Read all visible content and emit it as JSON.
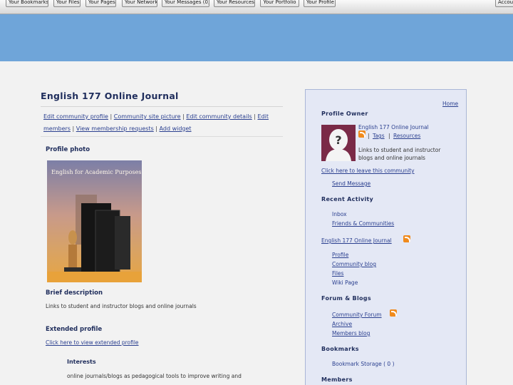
{
  "toolbar": {
    "buttons": [
      "Your Bookmarks",
      "Your Files",
      "Your Pages",
      "Your Network",
      "Your Messages (0)",
      "Your Resources",
      "Your Portfolio",
      "Your Profile"
    ],
    "account": "Account"
  },
  "main": {
    "title": "English 177 Online Journal",
    "owner_links": {
      "edit_profile": "Edit community profile",
      "edit_site_picture": "Community site picture",
      "edit_details": "Edit community details",
      "edit_members": "Edit members",
      "view_requests": "View membership requests",
      "add_widget": "Add widget"
    },
    "profile_photo_heading": "Profile photo",
    "photo": {
      "book_title": "English for Academic Purposes"
    },
    "brief_heading": "Brief description",
    "brief_text": "Links to student and instructor blogs and online journals",
    "extended_heading": "Extended profile",
    "extended_link": "Click here to view extended profile",
    "interests_heading": "Interests",
    "interests_text": "online journals/blogs as pedagogical tools to improve writing and"
  },
  "sidebar": {
    "home_link": "Home",
    "profile_owner_heading": "Profile Owner",
    "owner_name": "English 177 Online Journal",
    "owner_tags": "Tags",
    "owner_resources": "Resources",
    "owner_description": "Links to student and instructor blogs and online journals",
    "leave_link": "Click here to leave this community",
    "send_message": "Send Message",
    "recent_heading": "Recent Activity",
    "recent_items": [
      "Inbox",
      "Friends & Communities"
    ],
    "journal_link": "English 177 Online Journal",
    "journal_items": [
      "Profile",
      "Community blog",
      "Files",
      "Wiki Page"
    ],
    "forum_heading": "Forum & Blogs",
    "forum_items": [
      "Community Forum",
      "Archive",
      "Members blog"
    ],
    "bookmarks_heading": "Bookmarks",
    "bookmark_storage": "Bookmark Storage ( 0 )",
    "members_heading": "Members"
  },
  "colors": {
    "header_band": "#6fa5d9",
    "sidebar_bg": "#e4e8f5",
    "heading_text": "#1f2d5c",
    "link_text": "#2a3f8f",
    "rss_orange": "#f08a1c",
    "avatar_bg": "#7a2a47"
  },
  "icons": {
    "rss": "rss-feed-icon",
    "avatar": "default-avatar-question-icon"
  }
}
